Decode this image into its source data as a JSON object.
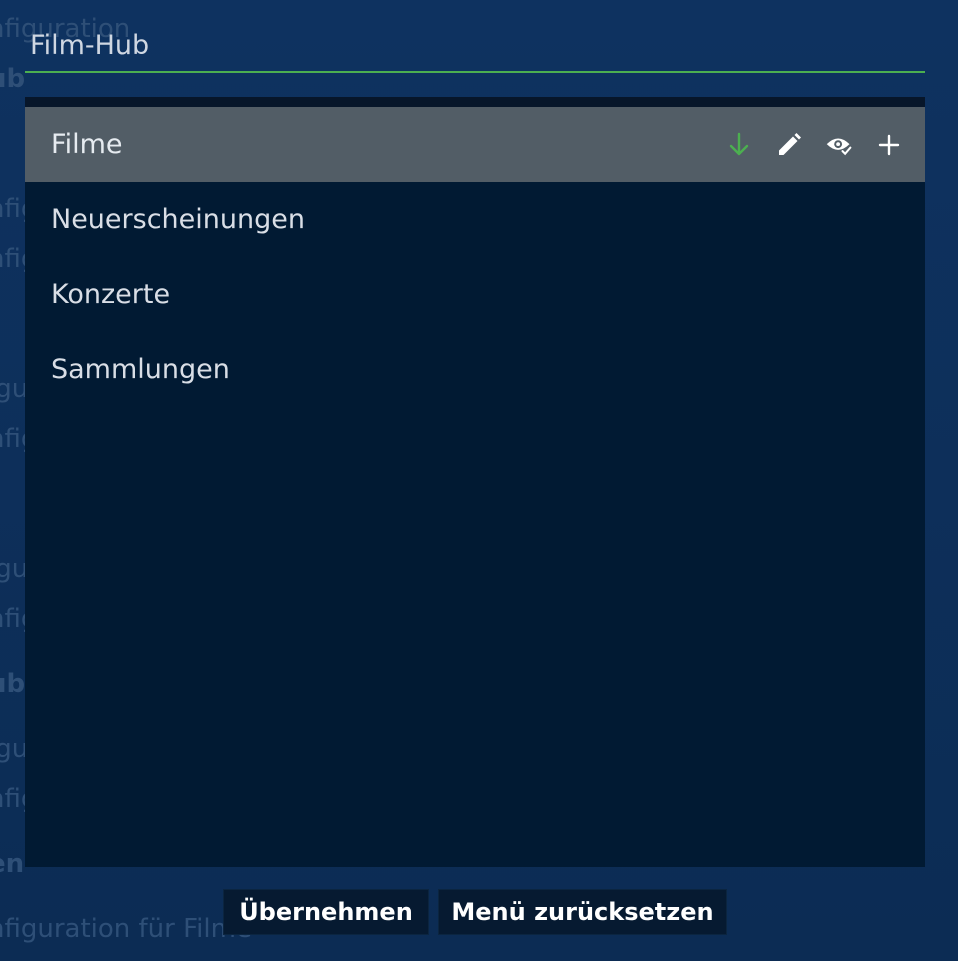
{
  "dialog": {
    "title": "Film-Hub",
    "accent_color": "#4caf50",
    "items": [
      {
        "label": "Filme",
        "selected": true
      },
      {
        "label": "Neuerscheinungen",
        "selected": false
      },
      {
        "label": "Konzerte",
        "selected": false
      },
      {
        "label": "Sammlungen",
        "selected": false
      }
    ],
    "item_actions": [
      "arrow-down-icon",
      "pencil-icon",
      "eye-check-icon",
      "plus-icon"
    ]
  },
  "buttons": {
    "apply_label": "Übernehmen",
    "reset_label": "Menü zurücksetzen"
  },
  "background": {
    "rows": [
      "nfiguration",
      "ub",
      "nfiguration",
      "nfiguration",
      "iguration",
      "nfiguration",
      "iguration",
      "nfiguration",
      "ub",
      "iguration",
      "nfiguration",
      "en",
      "nfiguration für Filme"
    ]
  }
}
